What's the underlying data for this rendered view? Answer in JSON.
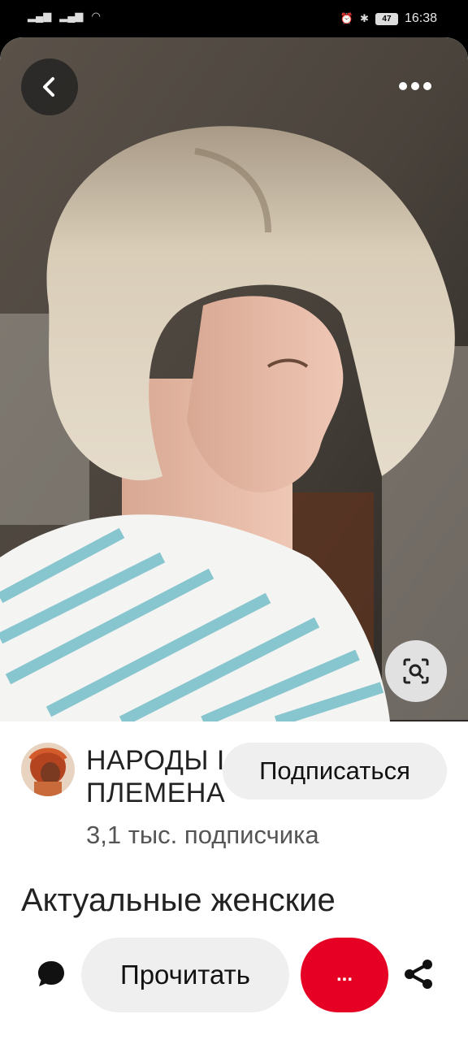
{
  "status_bar": {
    "time": "16:38",
    "battery": "47"
  },
  "pin": {
    "icons": {
      "back": "chevron-left-icon",
      "more": "more-horizontal-icon",
      "visual_search": "visual-search-icon"
    }
  },
  "creator": {
    "name": "НАРОДЫ І ЭТНОС. ПЛЕМЕНА",
    "followers": "3,1 тыс. подписчика",
    "follow_label": "Подписаться"
  },
  "title": "Актуальные женские",
  "actions": {
    "read_label": "Прочитать",
    "more_label": "...",
    "icons": {
      "comment": "comment-bubble-icon",
      "share": "share-icon"
    }
  },
  "colors": {
    "accent_red": "#e60023",
    "button_grey": "#efefef"
  }
}
